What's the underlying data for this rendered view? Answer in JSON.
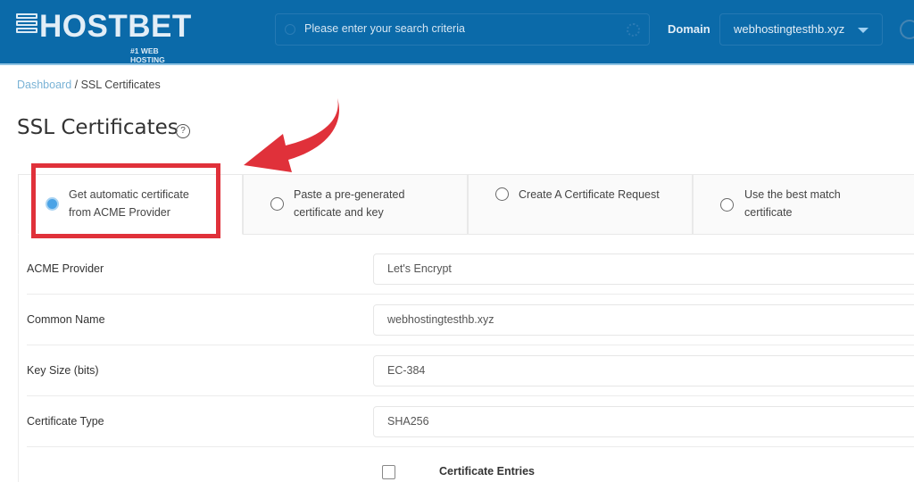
{
  "header": {
    "logo_text": "HOSTBET",
    "logo_tagline": "#1 WEB HOSTING",
    "search_placeholder": "Please enter your search criteria",
    "domain_label": "Domain",
    "domain_value": "webhostingtesthb.xyz",
    "colors": {
      "bar": "#0b6aa9",
      "accent": "#4aa3e6",
      "highlight": "#e0313a"
    }
  },
  "breadcrumb": {
    "root": "Dashboard",
    "separator": " / ",
    "current": "SSL Certificates"
  },
  "page": {
    "title": "SSL Certificates",
    "help_glyph": "?"
  },
  "tabs": [
    {
      "label_line1": "Get automatic certificate",
      "label_line2": "from ACME Provider",
      "selected": true
    },
    {
      "label_line1": "Paste a pre-generated",
      "label_line2": "certificate and key",
      "selected": false
    },
    {
      "label_line1": "Create A Certificate Request",
      "label_line2": "",
      "selected": false
    },
    {
      "label_line1": "Use the best match",
      "label_line2": "certificate",
      "selected": false
    }
  ],
  "form": {
    "rows": [
      {
        "label": "ACME Provider",
        "value": "Let's Encrypt"
      },
      {
        "label": "Common Name",
        "value": "webhostingtesthb.xyz"
      },
      {
        "label": "Key Size (bits)",
        "value": "EC-384"
      },
      {
        "label": "Certificate Type",
        "value": "SHA256"
      }
    ],
    "certificate_entries_label": "Certificate Entries",
    "certificate_entries_checked": false
  }
}
